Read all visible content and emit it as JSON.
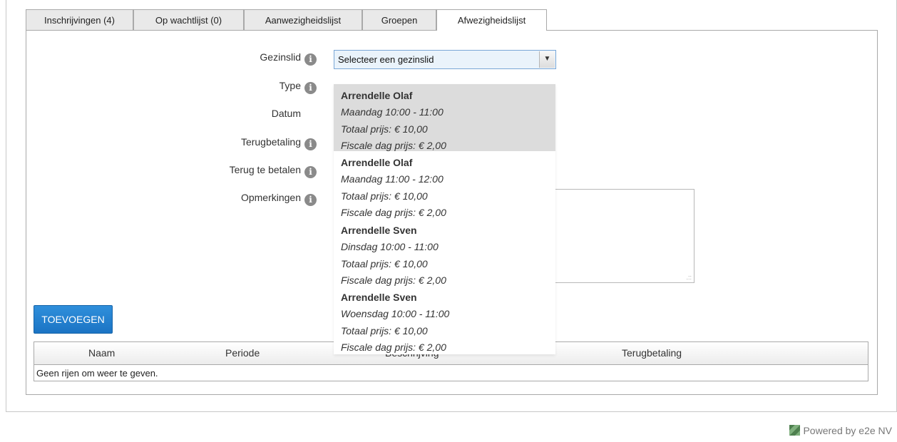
{
  "tabs": [
    {
      "label": "Inschrijvingen (4)"
    },
    {
      "label": "Op wachtlijst (0)"
    },
    {
      "label": "Aanwezigheidslijst"
    },
    {
      "label": "Groepen"
    },
    {
      "label": "Afwezigheidslijst",
      "active": true
    }
  ],
  "form": {
    "gezinslid_label": "Gezinslid",
    "gezinslid_value": "Selecteer een gezinslid",
    "type_label": "Type",
    "datum_label": "Datum",
    "terugbetaling_label": "Terugbetaling",
    "terug_te_betalen_label": "Terug te betalen",
    "opmerkingen_label": "Opmerkingen",
    "info_icon": "info-icon"
  },
  "dropdown_options": [
    {
      "name": "Arrendelle Olaf",
      "time": "Maandag 10:00 - 11:00",
      "total": "Totaal prijs: € 10,00",
      "fiscal": "Fiscale dag prijs: € 2,00",
      "highlighted": true
    },
    {
      "name": "Arrendelle Olaf",
      "time": "Maandag 11:00 - 12:00",
      "total": "Totaal prijs: € 10,00",
      "fiscal": "Fiscale dag prijs: € 2,00"
    },
    {
      "name": "Arrendelle Sven",
      "time": "Dinsdag 10:00 - 11:00",
      "total": "Totaal prijs: € 10,00",
      "fiscal": "Fiscale dag prijs: € 2,00"
    },
    {
      "name": "Arrendelle Sven",
      "time": "Woensdag 10:00 - 11:00",
      "total": "Totaal prijs: € 10,00",
      "fiscal": "Fiscale dag prijs: € 2,00"
    }
  ],
  "add_button_label": "TOEVOEGEN",
  "grid": {
    "columns": [
      "Naam",
      "Periode",
      "Beschrijving",
      "Terugbetaling"
    ],
    "empty_text": "Geen rijen om weer te geven."
  },
  "footer": {
    "text": "Powered by e2e NV"
  },
  "colors": {
    "button": "#1b74c4",
    "select_bg": "#eaf3fb",
    "highlight": "#dcdcdc"
  }
}
